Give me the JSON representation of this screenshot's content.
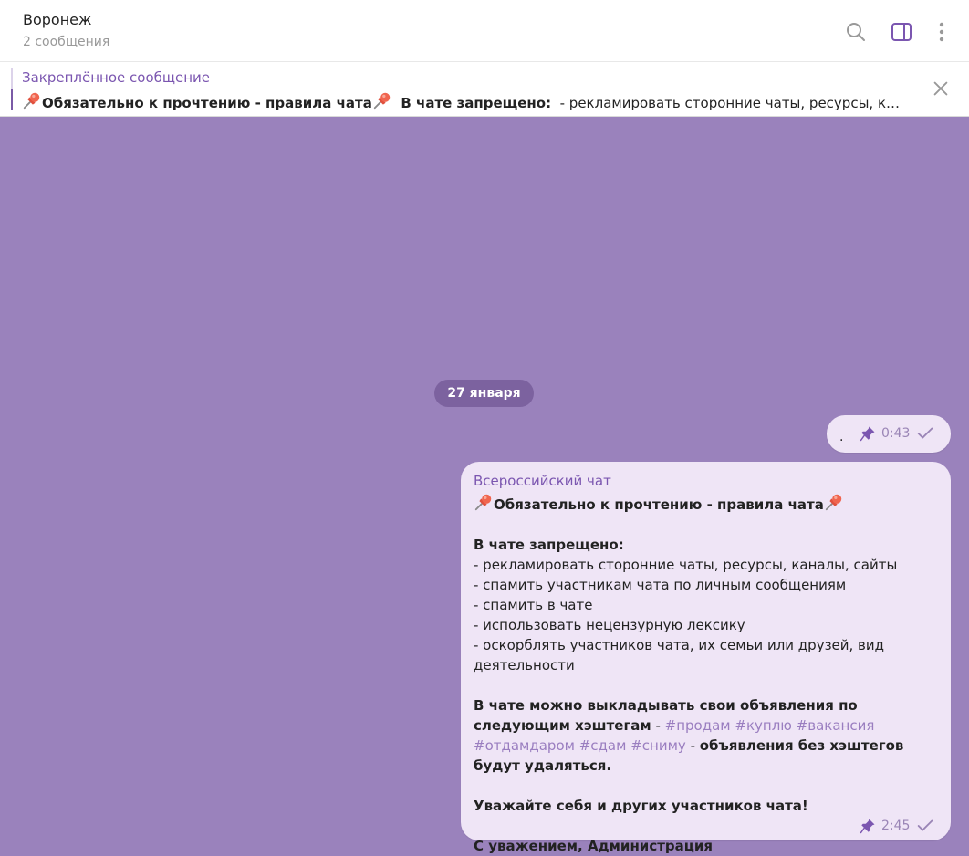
{
  "header": {
    "title": "Воронеж",
    "subtitle": "2 сообщения",
    "search_icon": "search-icon",
    "sidebar_icon": "sidebar-toggle-icon",
    "menu_icon": "more-vertical-icon"
  },
  "pinned": {
    "label": "Закреплённое сообщение",
    "bold_part": "Обязательно к прочтению - правила чата",
    "bold_part2": "В чате запрещено:",
    "rest": "- рекламировать сторонние чаты, ресурсы, каналы..."
  },
  "date_separator": "27 января",
  "messages": [
    {
      "text": ".",
      "time": "0:43"
    },
    {
      "sender": "Всероссийский чат",
      "headline": "Обязательно к прочтению - правила чата",
      "forbidden_title": "В чате запрещено:",
      "forbidden": [
        "- рекламировать сторонние чаты, ресурсы, каналы, сайты",
        "- спамить участникам чата по личным сообщениям",
        "- спамить в чате",
        "- использовать нецензурную лексику",
        "- оскорблять участников чата, их семьи или друзей, вид деятельности"
      ],
      "ads_bold": "В чате можно выкладывать свои объявления по следующим хэштегам",
      "ads_dash": " - ",
      "hashtags": [
        "#продам",
        "#куплю",
        "#вакансия",
        "#отдамдаром",
        "#сдам",
        "#сниму"
      ],
      "ads_dash2": " - ",
      "ads_tail": "объявления без хэштегов будут удаляться.",
      "respect": "Уважайте себя и других участников чата!",
      "signature": "С уважением, Администрация",
      "time": "2:45"
    }
  ],
  "colors": {
    "background": "#9a82bc",
    "accent": "#7b56b0",
    "bubble": "#efe5f6",
    "date_pill": "#7c629f"
  }
}
